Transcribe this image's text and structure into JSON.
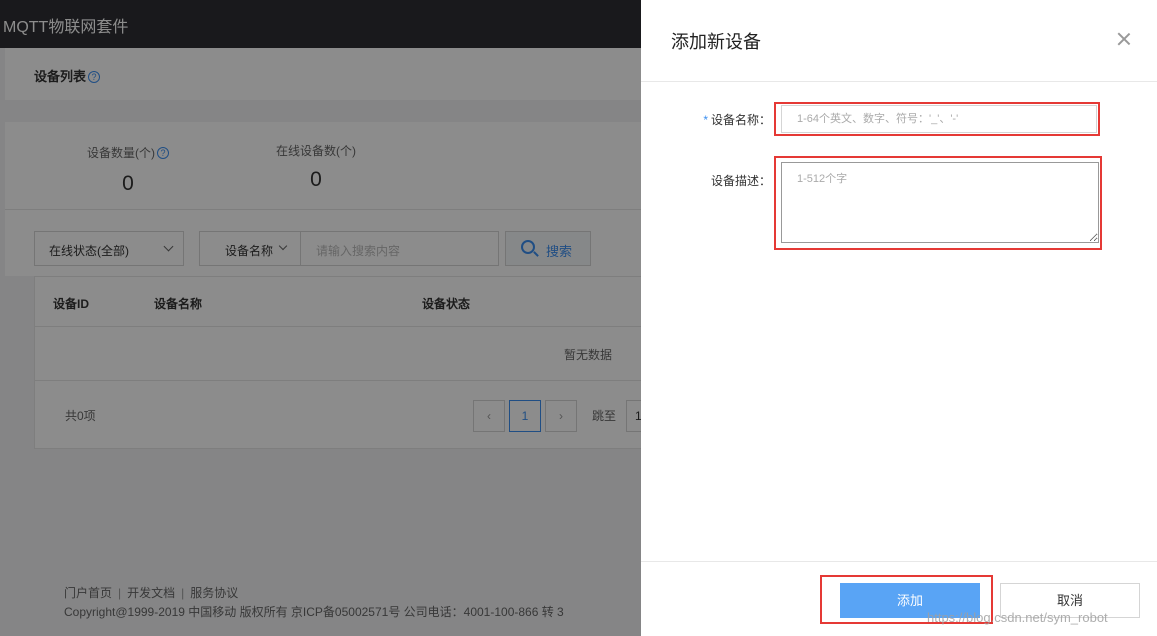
{
  "app": {
    "title": "MQTT物联网套件"
  },
  "page": {
    "title": "设备列表",
    "help_icon": "question-icon"
  },
  "stats": [
    {
      "label": "设备数量(个)",
      "value": "0"
    },
    {
      "label": "在线设备数(个)",
      "value": "0"
    }
  ],
  "filters": {
    "status_select": "在线状态(全部)",
    "field_select": "设备名称",
    "search_placeholder": "请输入搜索内容",
    "search_button": "搜索"
  },
  "table": {
    "columns": [
      "设备ID",
      "设备名称",
      "设备状态"
    ],
    "empty_text": "暂无数据"
  },
  "pagination": {
    "total": "共0项",
    "current_page": "1",
    "jump_label": "跳至",
    "jump_value": "1"
  },
  "footer": {
    "links": [
      "门户首页",
      "开发文档",
      "服务协议"
    ],
    "copyright": "Copyright@1999-2019 中国移动 版权所有 京ICP备05002571号 公司电话：4001-100-866 转 3"
  },
  "drawer": {
    "title": "添加新设备",
    "name_label": "设备名称：",
    "name_placeholder": "1-64个英文、数字、符号：'_'、'-'",
    "desc_label": "设备描述：",
    "desc_placeholder": "1-512个字",
    "add_button": "添加",
    "cancel_button": "取消"
  },
  "watermark": "https://blog.csdn.net/sym_robot",
  "colors": {
    "accent": "#3b8ff0",
    "primary_button": "#59a4f5",
    "highlight": "#e53935",
    "topbar": "#2e2f33"
  }
}
